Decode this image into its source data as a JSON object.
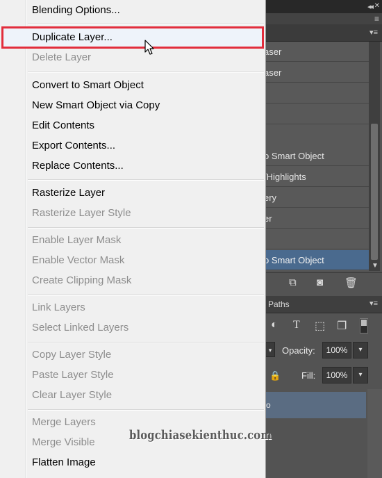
{
  "context_menu": {
    "items": [
      {
        "label": "Blending Options...",
        "enabled": true
      },
      {
        "label": "Duplicate Layer...",
        "enabled": true,
        "highlighted": true
      },
      {
        "label": "Delete Layer",
        "enabled": false
      },
      {
        "label": "Convert to Smart Object",
        "enabled": true
      },
      {
        "label": "New Smart Object via Copy",
        "enabled": true
      },
      {
        "label": "Edit Contents",
        "enabled": true
      },
      {
        "label": "Export Contents...",
        "enabled": true
      },
      {
        "label": "Replace Contents...",
        "enabled": true
      },
      {
        "label": "Rasterize Layer",
        "enabled": true
      },
      {
        "label": "Rasterize Layer Style",
        "enabled": false
      },
      {
        "label": "Enable Layer Mask",
        "enabled": false
      },
      {
        "label": "Enable Vector Mask",
        "enabled": false
      },
      {
        "label": "Create Clipping Mask",
        "enabled": false
      },
      {
        "label": "Link Layers",
        "enabled": false
      },
      {
        "label": "Select Linked Layers",
        "enabled": false
      },
      {
        "label": "Copy Layer Style",
        "enabled": false
      },
      {
        "label": "Paste Layer Style",
        "enabled": false
      },
      {
        "label": "Clear Layer Style",
        "enabled": false
      },
      {
        "label": "Merge Layers",
        "enabled": false
      },
      {
        "label": "Merge Visible",
        "enabled": false
      },
      {
        "label": "Flatten Image",
        "enabled": true
      }
    ],
    "highlight_color": "#e22d3c"
  },
  "history_panel": {
    "rows": [
      {
        "label": "aser",
        "active": false
      },
      {
        "label": "aser",
        "active": false
      },
      {
        "label": "",
        "active": false
      },
      {
        "label": "",
        "active": false
      },
      {
        "label": "o Smart Object",
        "active": false
      },
      {
        "label": "/Highlights",
        "active": false
      },
      {
        "label": "ery",
        "active": false
      },
      {
        "label": "er",
        "active": false
      },
      {
        "label": "",
        "active": false
      },
      {
        "label": "o Smart Object",
        "active": true
      }
    ],
    "active_color": "#4a6a8e"
  },
  "layers_panel": {
    "tab_paths": "Paths",
    "opacity_label": "Opacity:",
    "opacity_value": "100%",
    "fill_label": "Fill:",
    "fill_value": "100%",
    "selected_layer_fragment": "o",
    "selected_color": "#5a6c82"
  },
  "icons": {
    "collapse": "double-chevron-left-icon",
    "panel_menu": "panel-menu-icon",
    "new_snapshot": "new-document-from-state-icon",
    "camera": "camera-icon",
    "trash": "trash-icon",
    "adjustment": "adjustment-layer-icon",
    "type": "type-tool-icon",
    "shape": "shape-icon",
    "smart_object": "smart-object-icon",
    "lock": "lock-icon",
    "cursor": "mouse-pointer-icon"
  },
  "watermark": "blogchiasekienthuc.com"
}
